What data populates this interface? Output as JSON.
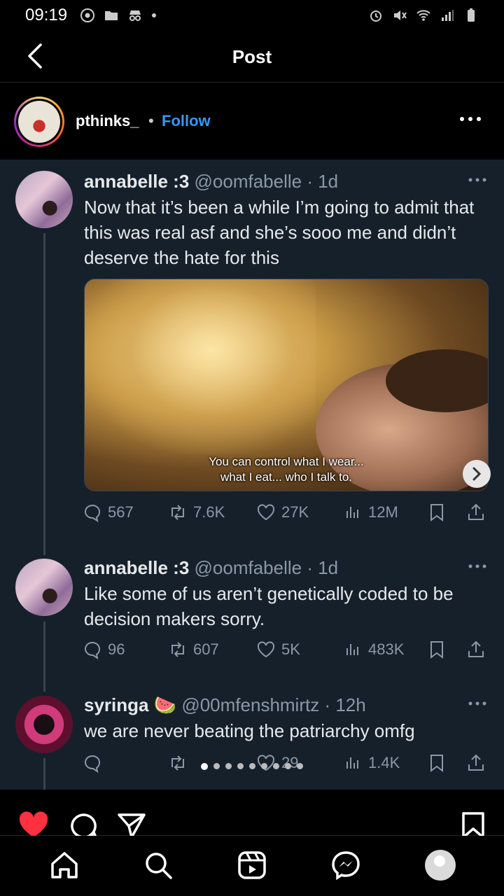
{
  "status_bar": {
    "time": "09:19"
  },
  "header": {
    "title": "Post"
  },
  "account": {
    "username": "pthinks_",
    "separator": "•",
    "follow_label": "Follow"
  },
  "tweets": [
    {
      "name": "annabelle :3",
      "handle_meta": "@oomfabelle · 1d",
      "text": "Now that it’s been a while I’m going to admit that this was real asf and she’s sooo me and didn’t deserve the hate for this",
      "media_caption_1": "You can control what I wear...",
      "media_caption_2": "what I eat... who I talk to.",
      "replies": "567",
      "retweets": "7.6K",
      "likes": "27K",
      "views": "12M"
    },
    {
      "name": "annabelle :3",
      "handle_meta": "@oomfabelle · 1d",
      "text": "Like some of us aren’t genetically coded to be decision makers sorry.",
      "replies": "96",
      "retweets": "607",
      "likes": "5K",
      "views": "483K"
    },
    {
      "name": "syringa 🍉",
      "handle_meta": "@00mfenshmirtz · 12h",
      "text": "we are never beating the patriarchy omfg",
      "replies": "",
      "retweets": "",
      "likes": "29",
      "views": "1.4K"
    }
  ],
  "carousel": {
    "count": 9,
    "active_index": 0
  },
  "colors": {
    "tweet_bg": "#15202b",
    "follow_blue": "#3897f0",
    "like_red": "#ff3040"
  },
  "icons": [
    "back-arrow-icon",
    "more-horizontal-icon",
    "heart-icon",
    "comment-icon",
    "share-icon",
    "bookmark-icon",
    "home-icon",
    "search-icon",
    "reels-icon",
    "messenger-icon"
  ]
}
